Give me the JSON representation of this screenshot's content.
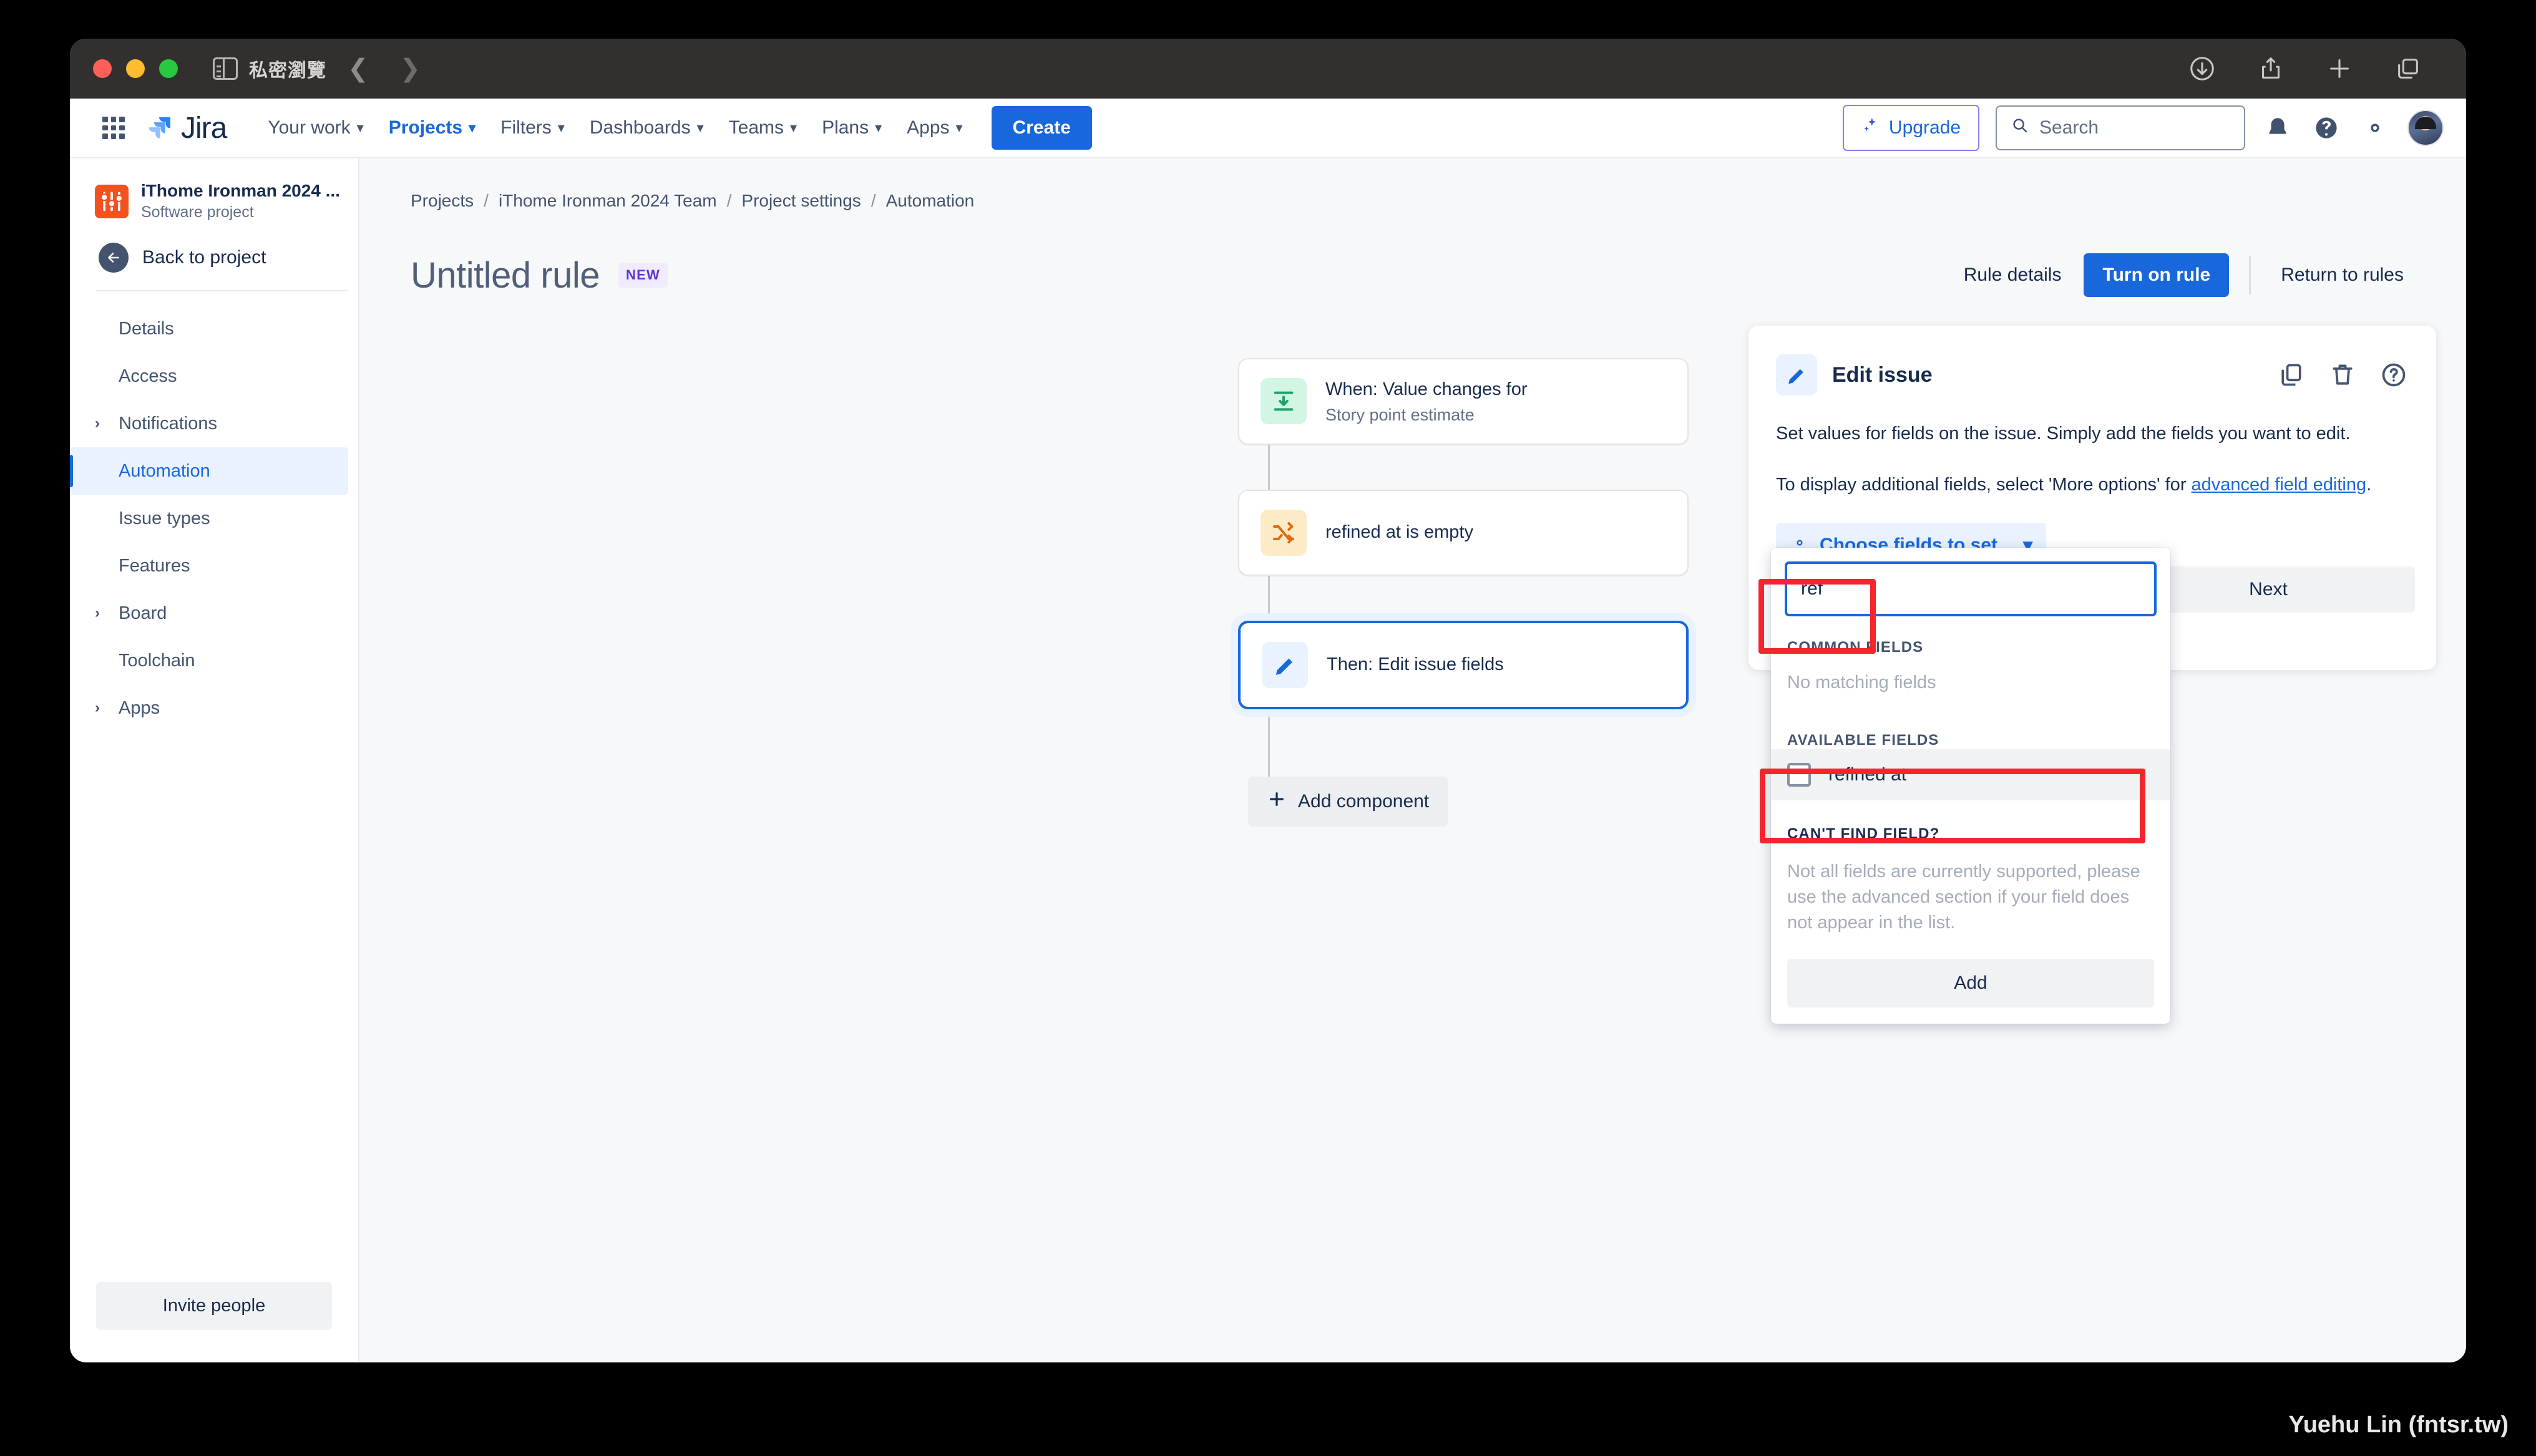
{
  "browser": {
    "private_label": "私密瀏覽",
    "back_icon": "chevron-left-icon",
    "forward_icon": "chevron-right-icon",
    "toolbar_icons": [
      "downloads-icon",
      "share-icon",
      "new-tab-icon",
      "tab-overview-icon"
    ]
  },
  "topnav": {
    "app_switcher_icon": "app-switcher-icon",
    "brand": "Jira",
    "items": [
      {
        "label": "Your work",
        "has_chevron": true,
        "active": false
      },
      {
        "label": "Projects",
        "has_chevron": true,
        "active": true
      },
      {
        "label": "Filters",
        "has_chevron": true,
        "active": false
      },
      {
        "label": "Dashboards",
        "has_chevron": true,
        "active": false
      },
      {
        "label": "Teams",
        "has_chevron": true,
        "active": false
      },
      {
        "label": "Plans",
        "has_chevron": true,
        "active": false
      },
      {
        "label": "Apps",
        "has_chevron": true,
        "active": false
      }
    ],
    "create_label": "Create",
    "upgrade_label": "Upgrade",
    "search_placeholder": "Search",
    "right_icons": [
      "notifications-icon",
      "help-icon",
      "settings-icon",
      "avatar"
    ],
    "accent_blue": "#1868db",
    "upgrade_purple": "#8f7ee7"
  },
  "sidebar": {
    "project_name": "iThome Ironman 2024 ...",
    "project_type": "Software project",
    "back_label": "Back to project",
    "items": [
      {
        "label": "Details",
        "expandable": false,
        "selected": false
      },
      {
        "label": "Access",
        "expandable": false,
        "selected": false
      },
      {
        "label": "Notifications",
        "expandable": true,
        "selected": false
      },
      {
        "label": "Automation",
        "expandable": false,
        "selected": true
      },
      {
        "label": "Issue types",
        "expandable": false,
        "selected": false
      },
      {
        "label": "Features",
        "expandable": false,
        "selected": false
      },
      {
        "label": "Board",
        "expandable": true,
        "selected": false
      },
      {
        "label": "Toolchain",
        "expandable": false,
        "selected": false
      },
      {
        "label": "Apps",
        "expandable": true,
        "selected": false
      }
    ],
    "invite_label": "Invite people"
  },
  "breadcrumb": {
    "items": [
      "Projects",
      "iThome Ironman 2024 Team",
      "Project settings",
      "Automation"
    ],
    "separator": "/"
  },
  "page": {
    "title": "Untitled rule",
    "badge": "NEW",
    "actions": {
      "rule_details": "Rule details",
      "turn_on_rule": "Turn on rule",
      "return_to_rules": "Return to rules"
    }
  },
  "rule_chain": {
    "nodes": [
      {
        "title": "When: Value changes for",
        "subtitle": "Story point estimate",
        "icon": "trigger-icon",
        "icon_tone": "green",
        "selected": false
      },
      {
        "title": "refined at is empty",
        "subtitle": "",
        "icon": "condition-icon",
        "icon_tone": "amber",
        "selected": false
      },
      {
        "title": "Then: Edit issue fields",
        "subtitle": "",
        "icon": "pencil-icon",
        "icon_tone": "blue",
        "selected": true
      }
    ],
    "add_component_label": "Add component"
  },
  "panel": {
    "title": "Edit issue",
    "icon": "pencil-icon",
    "actions": [
      "duplicate-icon",
      "trash-icon",
      "help-icon"
    ],
    "paragraph1": "Set values for fields on the issue. Simply add the fields you want to edit.",
    "paragraph2_pre": "To display additional fields, select 'More options' for ",
    "paragraph2_link": "advanced field editing",
    "paragraph2_post": ".",
    "choose_fields_label": "Choose fields to set...",
    "choose_fields_icon": "gear-icon",
    "next_label": "Next"
  },
  "dropdown": {
    "search_value": "ref",
    "common_fields_label": "COMMON FIELDS",
    "common_fields_empty": "No matching fields",
    "available_fields_label": "AVAILABLE FIELDS",
    "available_fields": [
      {
        "label": "refined at",
        "checked": false
      }
    ],
    "cant_find_title": "CAN'T FIND FIELD?",
    "cant_find_body": "Not all fields are currently supported, please use the advanced section if your field does not appear in the list.",
    "add_label": "Add"
  },
  "annotations": {
    "highlight_color": "#f4252c",
    "boxes": [
      "search-input-highlight",
      "available-fields-highlight"
    ]
  },
  "watermark": "Yuehu Lin (fntsr.tw)"
}
